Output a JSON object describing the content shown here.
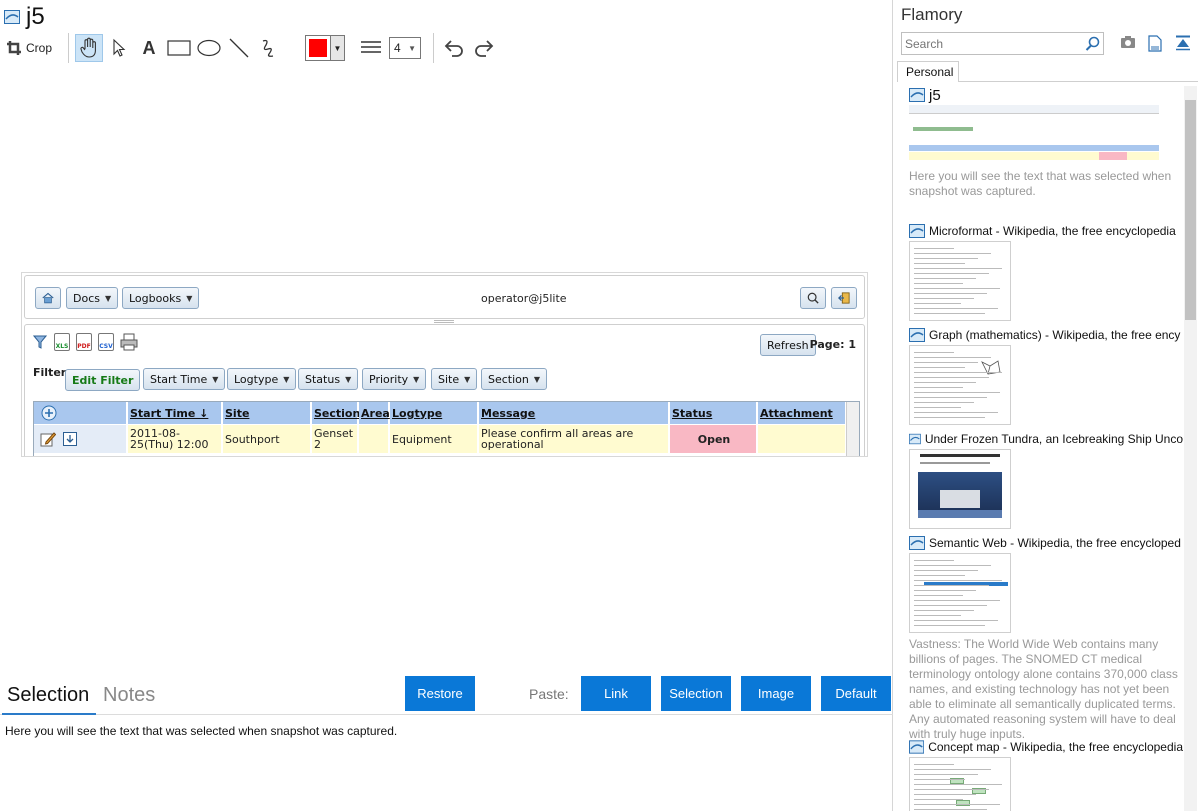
{
  "window": {
    "title": "j5"
  },
  "toolbar": {
    "crop_label": "Crop",
    "line_width": "4",
    "color": "#ff0000"
  },
  "snapshot": {
    "nav": {
      "docs": "Docs",
      "logbooks": "Logbooks",
      "user": "operator@j5lite"
    },
    "refresh": "Refresh",
    "page_label": "Page: 1",
    "file_icons": [
      "XLS",
      "PDF",
      "CSV"
    ],
    "filter_label": "Filter:",
    "edit_filter": "Edit Filter",
    "filters": [
      "Start Time",
      "Logtype",
      "Status",
      "Priority",
      "Site",
      "Section"
    ],
    "columns": [
      "Start Time ↓",
      "Site",
      "Section",
      "Area",
      "Logtype",
      "Message",
      "Status",
      "Attachment"
    ],
    "row": {
      "start_time": "2011-08-25(Thu) 12:00",
      "site": "Southport",
      "section": "Genset 2",
      "area": "",
      "logtype": "Equipment",
      "message": "Please confirm all areas are operational",
      "status": "Open",
      "attachment": ""
    }
  },
  "bottom": {
    "tabs": [
      "Selection",
      "Notes"
    ],
    "restore": "Restore",
    "paste_label": "Paste:",
    "paste_buttons": [
      "Link",
      "Selection",
      "Image",
      "Default"
    ],
    "selection_text": "Here you will see the text that was selected when snapshot was captured."
  },
  "sidebar": {
    "app_title": "Flamory",
    "search_placeholder": "Search",
    "tab": "Personal",
    "items": [
      {
        "title": "j5",
        "desc": "Here you will see the text that was selected when snapshot was captured."
      },
      {
        "title": "Microformat - Wikipedia, the free encyclopedia",
        "desc": ""
      },
      {
        "title": "Graph (mathematics) - Wikipedia, the free ency",
        "desc": ""
      },
      {
        "title": "Under Frozen Tundra, an Icebreaking Ship Unco",
        "desc": ""
      },
      {
        "title": "Semantic Web - Wikipedia, the free encycloped",
        "desc": "Vastness: The World Wide Web contains many billions of pages. The SNOMED CT medical terminology ontology alone contains 370,000 class names, and existing technology has not yet been able to eliminate all semantically duplicated terms. Any automated reasoning system will have to deal with truly huge inputs."
      },
      {
        "title": "Concept map - Wikipedia, the free encyclopedia",
        "desc": ""
      }
    ]
  },
  "colors": {
    "accent": "#0a78d7",
    "header_blue": "#a9c7ee",
    "row_yellow": "#fffbd0",
    "status_open": "#f9b8c4"
  }
}
